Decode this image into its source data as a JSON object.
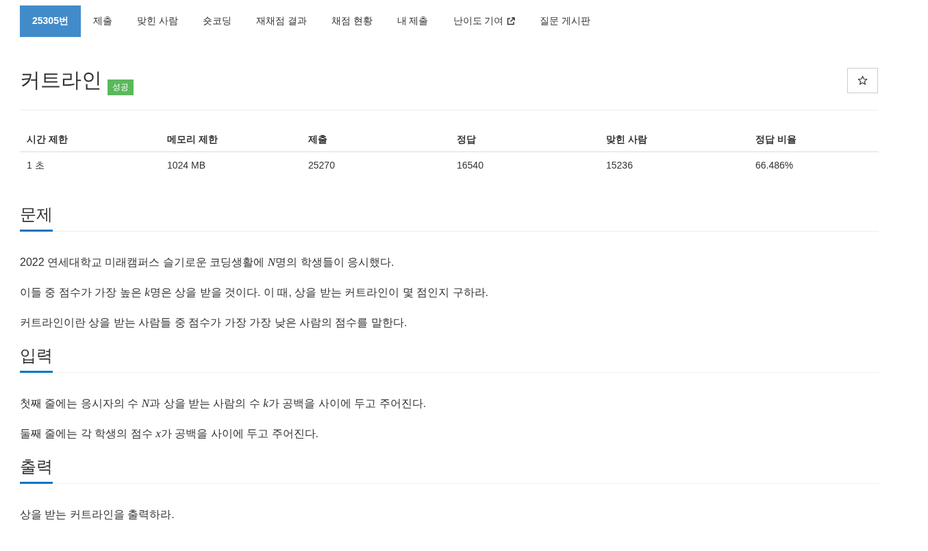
{
  "tabs": [
    {
      "label": "25305번",
      "selected": true,
      "external": false
    },
    {
      "label": "제출",
      "selected": false,
      "external": false
    },
    {
      "label": "맞힌 사람",
      "selected": false,
      "external": false
    },
    {
      "label": "숏코딩",
      "selected": false,
      "external": false
    },
    {
      "label": "재채점 결과",
      "selected": false,
      "external": false
    },
    {
      "label": "채점 현황",
      "selected": false,
      "external": false
    },
    {
      "label": "내 제출",
      "selected": false,
      "external": false
    },
    {
      "label": "난이도 기여",
      "selected": false,
      "external": true
    },
    {
      "label": "질문 게시판",
      "selected": false,
      "external": false
    }
  ],
  "problem": {
    "title": "커트라인",
    "badge": "성공",
    "starred": false
  },
  "info_table": {
    "columns": [
      "시간 제한",
      "메모리 제한",
      "제출",
      "정답",
      "맞힌 사람",
      "정답 비율"
    ],
    "rows": [
      [
        "1 초",
        "1024 MB",
        "25270",
        "16540",
        "15236",
        "66.486%"
      ]
    ]
  },
  "sections": [
    {
      "heading": "문제",
      "paragraphs": [
        [
          {
            "kind": "text",
            "text": "2022 연세대학교 미래캠퍼스 슬기로운 코딩생활에 "
          },
          {
            "kind": "math",
            "text": "N"
          },
          {
            "kind": "text",
            "text": "명의 학생들이 응시했다."
          }
        ],
        [
          {
            "kind": "text",
            "text": "이들 중 점수가 가장 높은 "
          },
          {
            "kind": "math",
            "text": "k"
          },
          {
            "kind": "text",
            "text": "명은 상을 받을 것이다. 이 때, 상을 받는 커트라인이 몇 점인지 구하라."
          }
        ],
        [
          {
            "kind": "text",
            "text": "커트라인이란 상을 받는 사람들 중 점수가 가장 가장 낮은 사람의 점수를 말한다."
          }
        ]
      ]
    },
    {
      "heading": "입력",
      "paragraphs": [
        [
          {
            "kind": "text",
            "text": "첫째 줄에는 응시자의 수 "
          },
          {
            "kind": "math",
            "text": "N"
          },
          {
            "kind": "text",
            "text": "과 상을 받는 사람의 수 "
          },
          {
            "kind": "math",
            "text": "k"
          },
          {
            "kind": "text",
            "text": "가 공백을 사이에 두고 주어진다."
          }
        ],
        [
          {
            "kind": "text",
            "text": "둘째 줄에는 각 학생의 점수 "
          },
          {
            "kind": "math",
            "text": "x"
          },
          {
            "kind": "text",
            "text": "가 공백을 사이에 두고 주어진다."
          }
        ]
      ]
    },
    {
      "heading": "출력",
      "paragraphs": [
        [
          {
            "kind": "text",
            "text": "상을 받는 커트라인을 출력하라."
          }
        ]
      ]
    }
  ]
}
